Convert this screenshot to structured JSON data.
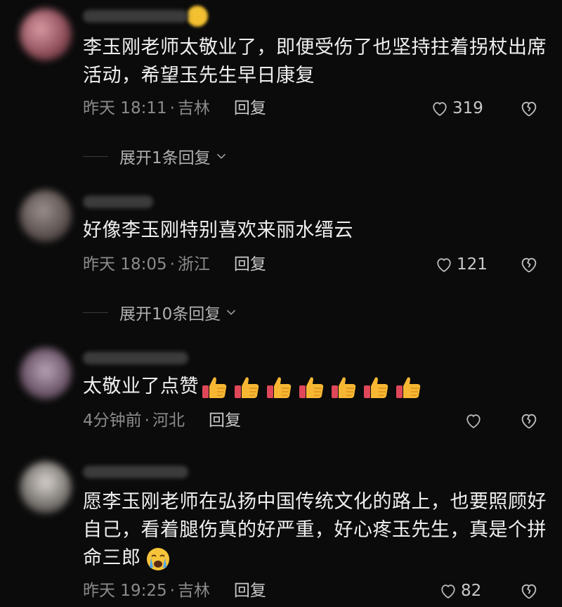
{
  "comments": [
    {
      "text": "李玉刚老师太敬业了，即便受伤了也坚持拄着拐杖出席活动，希望玉先生早日康复",
      "time": "昨天 18:11",
      "location": "吉林",
      "reply_label": "回复",
      "likes": "319",
      "expand_label": "展开1条回复"
    },
    {
      "text": "好像李玉刚特别喜欢来丽水缙云",
      "time": "昨天 18:05",
      "location": "浙江",
      "reply_label": "回复",
      "likes": "121",
      "expand_label": "展开10条回复"
    },
    {
      "text": "太敬业了点赞",
      "time": "4分钟前",
      "location": "河北",
      "reply_label": "回复",
      "likes": ""
    },
    {
      "text": "愿李玉刚老师在弘扬中国传统文化的路上，也要照顾好自己，看着腿伤真的好严重，好心疼玉先生，真是个拼命三郎",
      "time": "昨天 19:25",
      "location": "吉林",
      "reply_label": "回复",
      "likes": "82"
    }
  ],
  "separator": "·",
  "icons": {
    "like": "heart-outline-icon",
    "dislike": "broken-heart-icon",
    "expand": "chevron-down-icon",
    "thumbs": "thumbs-up-emoji",
    "crying": "crying-face-emoji"
  },
  "colors": {
    "background": "#0b0b0b",
    "text": "#efefef",
    "meta": "#8b8b8b"
  }
}
